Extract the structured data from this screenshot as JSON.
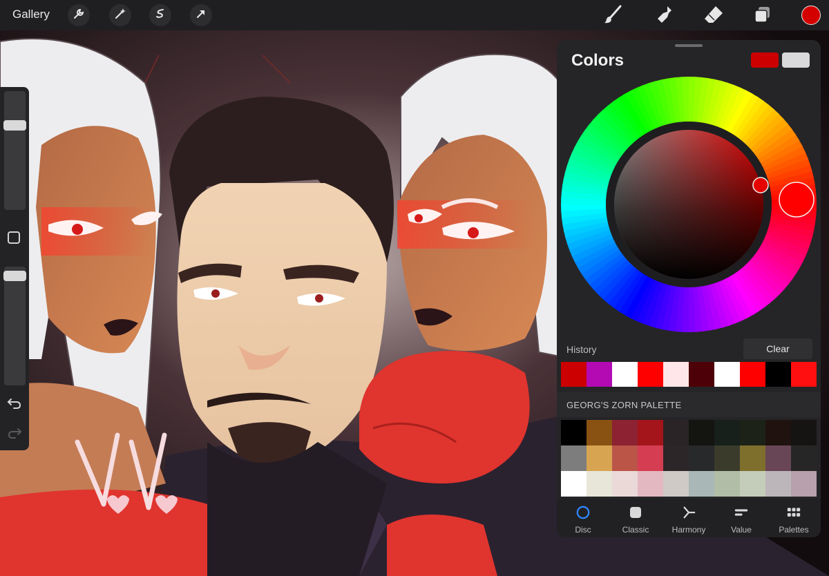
{
  "toolbar": {
    "gallery_label": "Gallery",
    "left_tools": [
      "wrench-icon",
      "magic-wand-icon",
      "selection-icon",
      "transform-arrow-icon"
    ],
    "right_tools": [
      "brush-icon",
      "smudge-icon",
      "eraser-icon",
      "layers-icon"
    ],
    "current_color": "#d40000"
  },
  "sidebar": {
    "brush_size_level": 0.73,
    "opacity_level": 0.96,
    "undo_icon": "undo-icon",
    "redo_icon": "redo-icon",
    "modify_icon": "square-modify-icon"
  },
  "colors_panel": {
    "title": "Colors",
    "primary_color": "#cc0000",
    "secondary_color": "#d9d9dc",
    "selected_hue_color": "#ff0000",
    "history_label": "History",
    "clear_label": "Clear",
    "history": [
      "#cc0000",
      "#b30ab3",
      "#ffffff",
      "#ff0000",
      "#ffe6e8",
      "#4d0008",
      "#ffffff",
      "#ff0000",
      "#000000",
      "#ff0f0f"
    ],
    "palette_name": "GEORG'S ZORN PALETTE",
    "palette": [
      "#000000",
      "#8a5212",
      "#8c2232",
      "#a3151a",
      "#2a2426",
      "#141411",
      "#18201b",
      "#1d2218",
      "#20130f",
      "#161313",
      "#7d7d7d",
      "#d7a451",
      "#bb5548",
      "#d43d52",
      "#2d2629",
      "#27292a",
      "#3b3b2c",
      "#7e6f2d",
      "#694655",
      "#262626",
      "#ffffff",
      "#e8e6d8",
      "#ebd9d8",
      "#e4b8c0",
      "#cfcac6",
      "#a9b7b7",
      "#b1bda6",
      "#c4cdb9",
      "#bcb6ba",
      "#b8a0ad"
    ],
    "tabs": [
      {
        "label": "Disc",
        "icon": "disc-icon",
        "active": true
      },
      {
        "label": "Classic",
        "icon": "classic-square-icon",
        "active": false
      },
      {
        "label": "Harmony",
        "icon": "harmony-icon",
        "active": false
      },
      {
        "label": "Value",
        "icon": "value-sliders-icon",
        "active": false
      },
      {
        "label": "Palettes",
        "icon": "palettes-grid-icon",
        "active": false
      }
    ]
  }
}
